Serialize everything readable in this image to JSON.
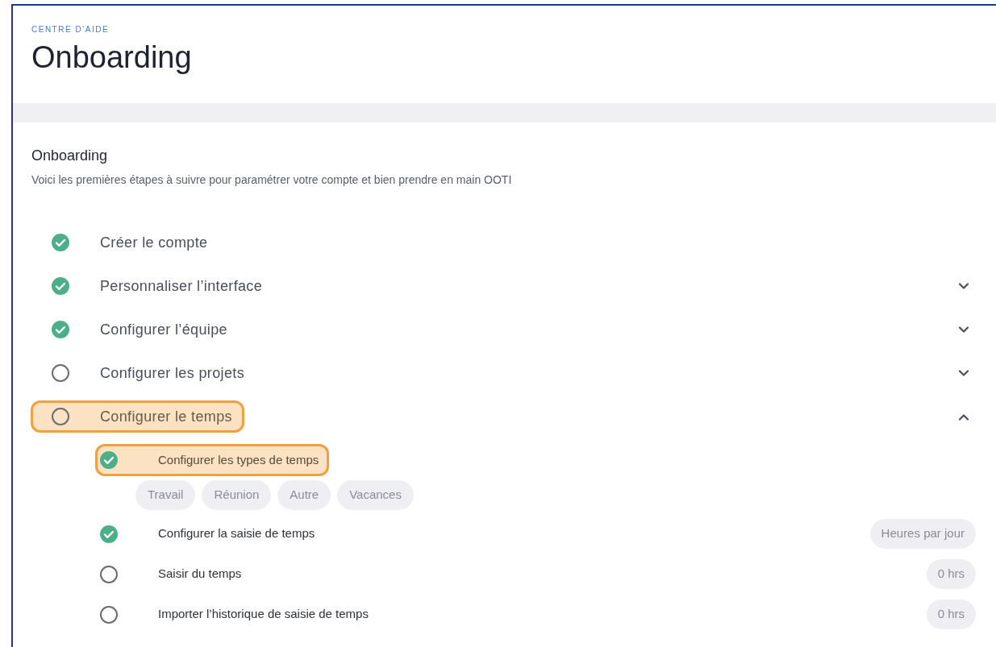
{
  "header": {
    "eyebrow": "CENTRE D’AIDE",
    "title": "Onboarding"
  },
  "card": {
    "title": "Onboarding",
    "description": "Voici les premières étapes à suivre pour paramétrer votre compte et bien prendre en main OOTI"
  },
  "steps": [
    {
      "label": "Créer le compte",
      "done": true,
      "highlighted": false
    },
    {
      "label": "Personnaliser l’interface",
      "done": true,
      "highlighted": false,
      "expanded": false
    },
    {
      "label": "Configurer l’équipe",
      "done": true,
      "highlighted": false,
      "expanded": false
    },
    {
      "label": "Configurer les projets",
      "done": false,
      "highlighted": false,
      "expanded": false
    },
    {
      "label": "Configurer le temps",
      "done": false,
      "highlighted": true,
      "expanded": true,
      "substeps": [
        {
          "label": "Configurer les types de temps",
          "done": true,
          "highlighted": true,
          "tags": [
            "Travail",
            "Réunion",
            "Autre",
            "Vacances"
          ]
        },
        {
          "label": "Configurer la saisie de temps",
          "done": true,
          "highlighted": false,
          "badge": "Heures par jour"
        },
        {
          "label": "Saisir du temps",
          "done": false,
          "highlighted": false,
          "badge": "0 hrs"
        },
        {
          "label": "Importer l’historique de saisie de temps",
          "done": false,
          "highlighted": false,
          "badge": "0 hrs"
        }
      ]
    }
  ]
}
